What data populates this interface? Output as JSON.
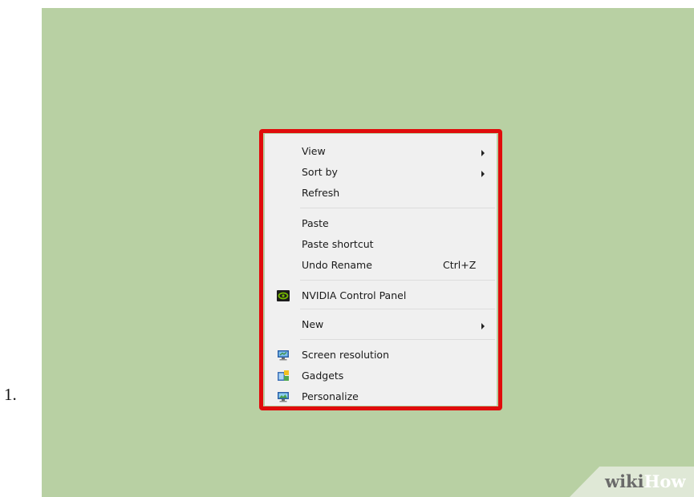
{
  "step": {
    "number": "1."
  },
  "context_menu": {
    "items": [
      {
        "label": "View",
        "has_submenu": true
      },
      {
        "label": "Sort by",
        "has_submenu": true
      },
      {
        "label": "Refresh"
      },
      {
        "label": "Paste",
        "disabled": true
      },
      {
        "label": "Paste shortcut",
        "disabled": true
      },
      {
        "label": "Undo Rename",
        "shortcut": "Ctrl+Z"
      },
      {
        "label": "NVIDIA Control Panel",
        "icon": "nvidia-icon"
      },
      {
        "label": "New",
        "has_submenu": true
      },
      {
        "label": "Screen resolution",
        "icon": "monitor-icon"
      },
      {
        "label": "Gadgets",
        "icon": "gadgets-icon"
      },
      {
        "label": "Personalize",
        "icon": "personalize-icon"
      }
    ]
  },
  "colors": {
    "desktop_background": "#b8d0a3",
    "highlight_border": "#e00c0c",
    "menu_background": "#f0f0f0"
  },
  "watermark": {
    "part1": "wiki",
    "part2": "How"
  }
}
